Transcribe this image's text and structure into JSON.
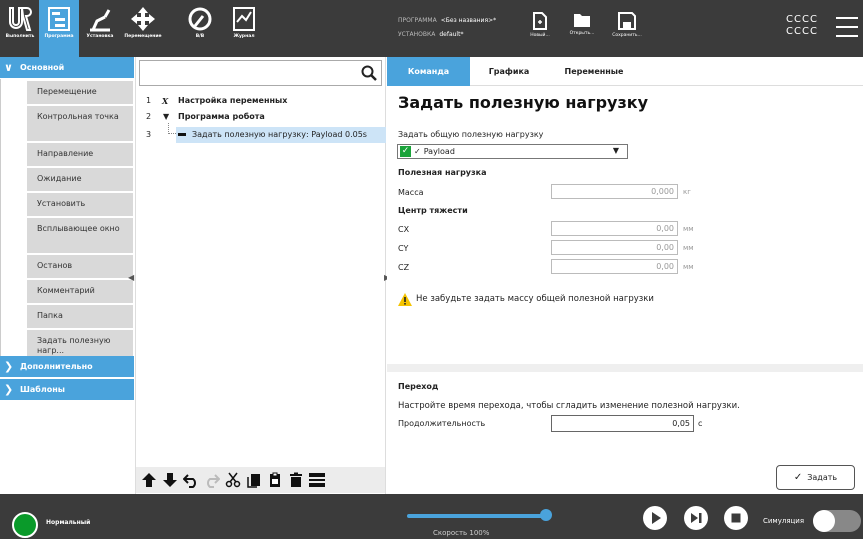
{
  "nav": [
    {
      "id": "run",
      "label": "Выполнить"
    },
    {
      "id": "program",
      "label": "Программа"
    },
    {
      "id": "installation",
      "label": "Установка"
    },
    {
      "id": "move",
      "label": "Перемещение"
    },
    {
      "id": "io",
      "label": "В/В"
    },
    {
      "id": "log",
      "label": "Журнал"
    }
  ],
  "program_info": {
    "program_label": "ПРОГРАММА",
    "program_name": "<Без названия>*",
    "installation_label": "УСТАНОВКА",
    "installation_name": "default*"
  },
  "file_buttons": {
    "new": "Новый...",
    "open": "Открыть...",
    "save": "Сохранить..."
  },
  "robot_name": {
    "line1": "CCCC",
    "line2": "CCCC"
  },
  "toolbox": {
    "basic": "Основной",
    "items": [
      "Перемещение",
      "Контрольная точка",
      "Направление",
      "Ожидание",
      "Установить",
      "Всплывающее окно",
      "Останов",
      "Комментарий",
      "Папка",
      "Задать полезную нагр..."
    ],
    "advanced": "Дополнительно",
    "templates": "Шаблоны"
  },
  "tree": {
    "line1_num": "1",
    "line1_text": "Настройка переменных",
    "line2_num": "2",
    "line2_text": "Программа робота",
    "line3_num": "3",
    "line3_text": "Задать полезную нагрузку: Payload 0.05s"
  },
  "tabs": {
    "command": "Команда",
    "graphics": "Графика",
    "variables": "Переменные"
  },
  "panel": {
    "title": "Задать полезную нагрузку",
    "select_label": "Задать общую полезную нагрузку",
    "selected_payload": "Payload",
    "payload_header": "Полезная нагрузка",
    "mass_label": "Масса",
    "mass_value": "0,000",
    "mass_unit": "кг",
    "cog_header": "Центр тяжести",
    "cx_label": "CX",
    "cx_value": "0,00",
    "cy_label": "CY",
    "cy_value": "0,00",
    "cz_label": "CZ",
    "cz_value": "0,00",
    "mm_unit": "мм",
    "warning": "Не забудьте задать массу общей полезной нагрузки",
    "transition_header": "Переход",
    "transition_desc": "Настройте время перехода, чтобы сгладить изменение полезной нагрузки.",
    "duration_label": "Продолжительность",
    "duration_value": "0,05",
    "duration_unit": "с",
    "set_button": "Задать"
  },
  "bottom": {
    "status": "Нормальный",
    "speed": "Скорость 100%",
    "speed_fraction": 1.0,
    "simulation": "Симуляция"
  },
  "colors": {
    "accent": "#4aa3dc",
    "bar": "#3b3b3b",
    "status_ok": "#0a9a2a",
    "selection": "#cde4f7"
  }
}
